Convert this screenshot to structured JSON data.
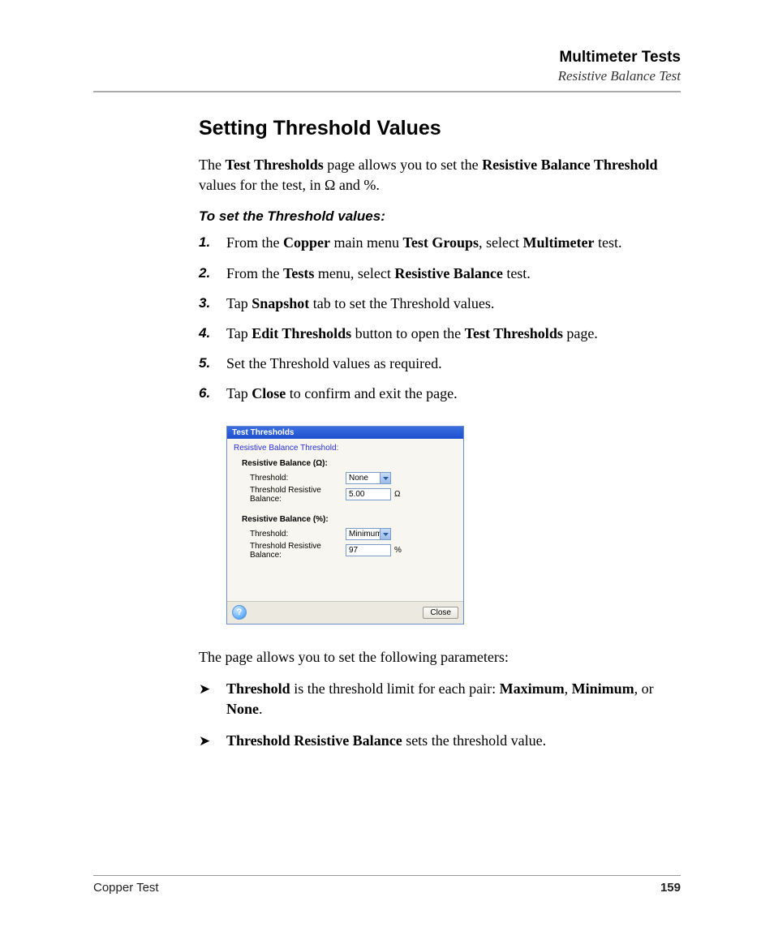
{
  "header": {
    "title": "Multimeter Tests",
    "subtitle": "Resistive Balance Test"
  },
  "section_title": "Setting Threshold Values",
  "intro": {
    "t1": "The ",
    "b1": "Test Thresholds",
    "t2": " page allows you to set the ",
    "b2": "Resistive Balance Threshold",
    "t3": " values for the test, in Ω and %."
  },
  "steps_heading": "To set the Threshold values:",
  "steps": [
    {
      "t1": "From the ",
      "b1": "Copper",
      "t2": " main menu ",
      "b2": "Test Groups",
      "t3": ", select ",
      "b3": "Multimeter",
      "t4": " test."
    },
    {
      "t1": "From the ",
      "b1": "Tests",
      "t2": " menu, select ",
      "b2": "Resistive Balance",
      "t3": " test."
    },
    {
      "t1": "Tap ",
      "b1": "Snapshot",
      "t2": " tab to set the Threshold values."
    },
    {
      "t1": "Tap ",
      "b1": "Edit Thresholds",
      "t2": " button to open the ",
      "b2": "Test Thresholds",
      "t3": " page."
    },
    {
      "t1": "Set the Threshold values as required."
    },
    {
      "t1": "Tap ",
      "b1": "Close",
      "t2": " to confirm and exit the page."
    }
  ],
  "dialog": {
    "title": "Test Thresholds",
    "group_title": "Resistive Balance Threshold:",
    "section1": {
      "title": "Resistive Balance (Ω):",
      "row1_label": "Threshold:",
      "row1_value": "None",
      "row2_label": "Threshold Resistive Balance:",
      "row2_value": "5.00",
      "row2_unit": "Ω"
    },
    "section2": {
      "title": "Resistive Balance (%):",
      "row1_label": "Threshold:",
      "row1_value": "Minimum",
      "row2_label": "Threshold Resistive Balance:",
      "row2_value": "97",
      "row2_unit": "%"
    },
    "help_glyph": "?",
    "close_label": "Close"
  },
  "after_para": "The page allows you to set the following parameters:",
  "bullets": [
    {
      "b1": "Threshold",
      "t1": " is the threshold limit for each pair: ",
      "b2": "Maximum",
      "t2": ", ",
      "b3": "Minimum",
      "t3": ", or ",
      "b4": "None",
      "t4": "."
    },
    {
      "b1": "Threshold Resistive Balance",
      "t1": " sets the threshold value."
    }
  ],
  "footer": {
    "left": "Copper Test",
    "page": "159"
  }
}
